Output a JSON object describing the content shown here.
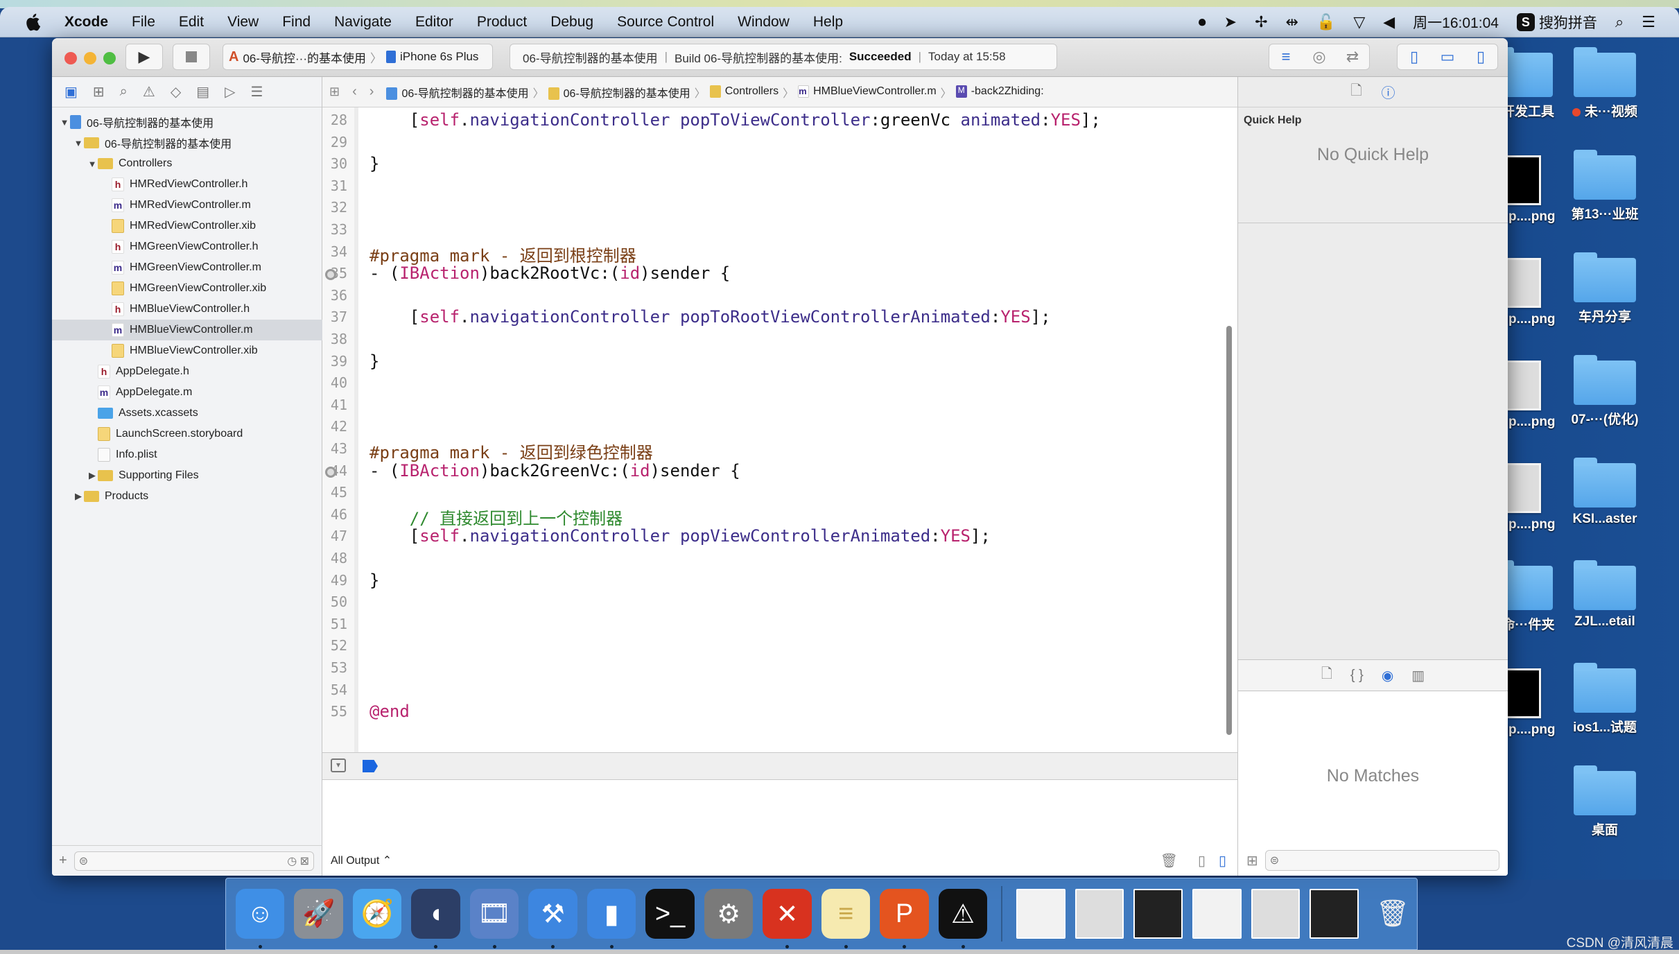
{
  "menubar": {
    "app": "Xcode",
    "items": [
      "File",
      "Edit",
      "View",
      "Find",
      "Navigate",
      "Editor",
      "Product",
      "Debug",
      "Source Control",
      "Window",
      "Help"
    ],
    "clock": "周一16:01:04",
    "input_method": "搜狗拼音",
    "status_icons": [
      "screen-record-icon",
      "location-icon",
      "bluetooth-like-icon",
      "network-icon",
      "lock-icon",
      "wifi-icon",
      "volume-icon"
    ]
  },
  "toolbar": {
    "scheme": "06-导航控···的基本使用",
    "device": "iPhone 6s Plus",
    "activity_project": "06-导航控制器的基本使用",
    "activity_build_prefix": "Build 06-导航控制器的基本使用:",
    "activity_status": "Succeeded",
    "activity_time": "Today at 15:58"
  },
  "navigator": {
    "rows": [
      {
        "label": "06-导航控制器的基本使用",
        "icon": "proj",
        "indent": 0,
        "disclosure": "open"
      },
      {
        "label": "06-导航控制器的基本使用",
        "icon": "folder",
        "indent": 1,
        "disclosure": "open"
      },
      {
        "label": "Controllers",
        "icon": "folder",
        "indent": 2,
        "disclosure": "open"
      },
      {
        "label": "HMRedViewController.h",
        "icon": "h",
        "indent": 3
      },
      {
        "label": "HMRedViewController.m",
        "icon": "m",
        "indent": 3
      },
      {
        "label": "HMRedViewController.xib",
        "icon": "xib",
        "indent": 3
      },
      {
        "label": "HMGreenViewController.h",
        "icon": "h",
        "indent": 3
      },
      {
        "label": "HMGreenViewController.m",
        "icon": "m",
        "indent": 3
      },
      {
        "label": "HMGreenViewController.xib",
        "icon": "xib",
        "indent": 3
      },
      {
        "label": "HMBlueViewController.h",
        "icon": "h",
        "indent": 3
      },
      {
        "label": "HMBlueViewController.m",
        "icon": "m",
        "indent": 3,
        "selected": true
      },
      {
        "label": "HMBlueViewController.xib",
        "icon": "xib",
        "indent": 3
      },
      {
        "label": "AppDelegate.h",
        "icon": "h",
        "indent": 2
      },
      {
        "label": "AppDelegate.m",
        "icon": "m",
        "indent": 2
      },
      {
        "label": "Assets.xcassets",
        "icon": "assets",
        "indent": 2
      },
      {
        "label": "LaunchScreen.storyboard",
        "icon": "sb",
        "indent": 2
      },
      {
        "label": "Info.plist",
        "icon": "plist",
        "indent": 2
      },
      {
        "label": "Supporting Files",
        "icon": "folder",
        "indent": 2,
        "disclosure": "closed"
      },
      {
        "label": "Products",
        "icon": "folder",
        "indent": 1,
        "disclosure": "closed"
      }
    ]
  },
  "jumpbar": {
    "crumbs": [
      "06-导航控制器的基本使用",
      "06-导航控制器的基本使用",
      "Controllers",
      "HMBlueViewController.m",
      "-back2Zhiding:"
    ]
  },
  "editor": {
    "lines": [
      {
        "n": 28,
        "code": [
          [
            "    [",
            ""
          ],
          [
            "self",
            "kw"
          ],
          [
            ".",
            ""
          ],
          [
            "navigationController",
            "meth"
          ],
          [
            " ",
            ""
          ],
          [
            "popToViewController",
            "meth"
          ],
          [
            ":greenVc ",
            ""
          ],
          [
            "animated",
            "meth"
          ],
          [
            ":",
            ""
          ],
          [
            "YES",
            "kw"
          ],
          [
            "];",
            ""
          ]
        ]
      },
      {
        "n": 29,
        "code": []
      },
      {
        "n": 30,
        "code": [
          [
            "}",
            ""
          ]
        ]
      },
      {
        "n": 31,
        "code": []
      },
      {
        "n": 32,
        "code": []
      },
      {
        "n": 33,
        "code": []
      },
      {
        "n": 34,
        "code": [
          [
            "#pragma mark - 返回到根控制器",
            "pp"
          ]
        ]
      },
      {
        "n": 35,
        "bp": true,
        "code": [
          [
            "- (",
            ""
          ],
          [
            "IBAction",
            "kw"
          ],
          [
            ")back2RootVc:(",
            ""
          ],
          [
            "id",
            "kw"
          ],
          [
            ")sender {",
            ""
          ]
        ]
      },
      {
        "n": 36,
        "code": []
      },
      {
        "n": 37,
        "code": [
          [
            "    [",
            ""
          ],
          [
            "self",
            "kw"
          ],
          [
            ".",
            ""
          ],
          [
            "navigationController",
            "meth"
          ],
          [
            " ",
            ""
          ],
          [
            "popToRootViewControllerAnimated",
            "meth"
          ],
          [
            ":",
            ""
          ],
          [
            "YES",
            "kw"
          ],
          [
            "];",
            ""
          ]
        ]
      },
      {
        "n": 38,
        "code": []
      },
      {
        "n": 39,
        "code": [
          [
            "}",
            ""
          ]
        ]
      },
      {
        "n": 40,
        "code": []
      },
      {
        "n": 41,
        "code": []
      },
      {
        "n": 42,
        "code": []
      },
      {
        "n": 43,
        "code": [
          [
            "#pragma mark - 返回到绿色控制器",
            "pp"
          ]
        ]
      },
      {
        "n": 44,
        "bp": true,
        "code": [
          [
            "- (",
            ""
          ],
          [
            "IBAction",
            "kw"
          ],
          [
            ")back2GreenVc:(",
            ""
          ],
          [
            "id",
            "kw"
          ],
          [
            ")sender {",
            ""
          ]
        ]
      },
      {
        "n": 45,
        "code": []
      },
      {
        "n": 46,
        "code": [
          [
            "    // 直接返回到上一个控制器",
            "cm"
          ]
        ]
      },
      {
        "n": 47,
        "code": [
          [
            "    [",
            ""
          ],
          [
            "self",
            "kw"
          ],
          [
            ".",
            ""
          ],
          [
            "navigationController",
            "meth"
          ],
          [
            " ",
            ""
          ],
          [
            "popViewControllerAnimated",
            "meth"
          ],
          [
            ":",
            ""
          ],
          [
            "YES",
            "kw"
          ],
          [
            "];",
            ""
          ]
        ]
      },
      {
        "n": 48,
        "code": []
      },
      {
        "n": 49,
        "code": [
          [
            "}",
            ""
          ]
        ]
      },
      {
        "n": 50,
        "code": []
      },
      {
        "n": 51,
        "code": []
      },
      {
        "n": 52,
        "code": []
      },
      {
        "n": 53,
        "code": []
      },
      {
        "n": 54,
        "code": []
      },
      {
        "n": 55,
        "code": [
          [
            "@end",
            "kw"
          ]
        ]
      }
    ]
  },
  "console": {
    "output_selector": "All Output ⌃"
  },
  "inspector": {
    "quick_help_title": "Quick Help",
    "quick_help_empty": "No Quick Help",
    "library_empty": "No Matches"
  },
  "desktop": {
    "icons": [
      {
        "label": "开发工具",
        "type": "folder",
        "tag_color": "#5ec23e"
      },
      {
        "label": "未···视频",
        "type": "folder",
        "tag_color": "#e8482c"
      },
      {
        "label": "Snip....png",
        "type": "thumb-black"
      },
      {
        "label": "第13···业班",
        "type": "folder"
      },
      {
        "label": "Snip....png",
        "type": "thumb"
      },
      {
        "label": "车丹分享",
        "type": "folder"
      },
      {
        "label": "Snip....png",
        "type": "thumb"
      },
      {
        "label": "07-···(优化)",
        "type": "folder"
      },
      {
        "label": "Snip....png",
        "type": "thumb"
      },
      {
        "label": "KSI...aster",
        "type": "folder"
      },
      {
        "label": "未命···件夹",
        "type": "folder"
      },
      {
        "label": "ZJL...etail",
        "type": "folder"
      },
      {
        "label": "Snip....png",
        "type": "thumb-black"
      },
      {
        "label": "ios1...试题",
        "type": "folder"
      },
      {
        "label": "桌面",
        "type": "folder"
      }
    ]
  },
  "dock": {
    "apps": [
      {
        "name": "finder",
        "glyph": "☺",
        "bg": "#3f8fe6",
        "running": true
      },
      {
        "name": "launchpad",
        "glyph": "🚀",
        "bg": "#8a8f96",
        "running": false
      },
      {
        "name": "safari",
        "glyph": "🧭",
        "bg": "#4aa6ef",
        "running": false
      },
      {
        "name": "mouse-app",
        "glyph": "◖",
        "bg": "#2c3e66",
        "running": true
      },
      {
        "name": "video-app",
        "glyph": "🎞",
        "bg": "#5a82c8",
        "running": true
      },
      {
        "name": "xcode",
        "glyph": "⚒",
        "bg": "#3d86e0",
        "running": true
      },
      {
        "name": "simulator",
        "glyph": "▮",
        "bg": "#3d86e0",
        "running": true
      },
      {
        "name": "terminal",
        "glyph": ">_",
        "bg": "#111",
        "running": false
      },
      {
        "name": "system-preferences",
        "glyph": "⚙",
        "bg": "#7a7a7a",
        "running": false
      },
      {
        "name": "xmind",
        "glyph": "✕",
        "bg": "#d8321f",
        "running": true
      },
      {
        "name": "notes",
        "glyph": "≡",
        "bg": "#f6eab0",
        "running": true
      },
      {
        "name": "powerpoint-like",
        "glyph": "P",
        "bg": "#e4541f",
        "running": true
      },
      {
        "name": "console-app",
        "glyph": "⚠",
        "bg": "#111",
        "running": true
      }
    ],
    "minimized": [
      "window-1",
      "window-2",
      "window-3",
      "window-4",
      "window-5",
      "window-6"
    ],
    "trash": "trash"
  },
  "watermark": "CSDN @清风清晨"
}
